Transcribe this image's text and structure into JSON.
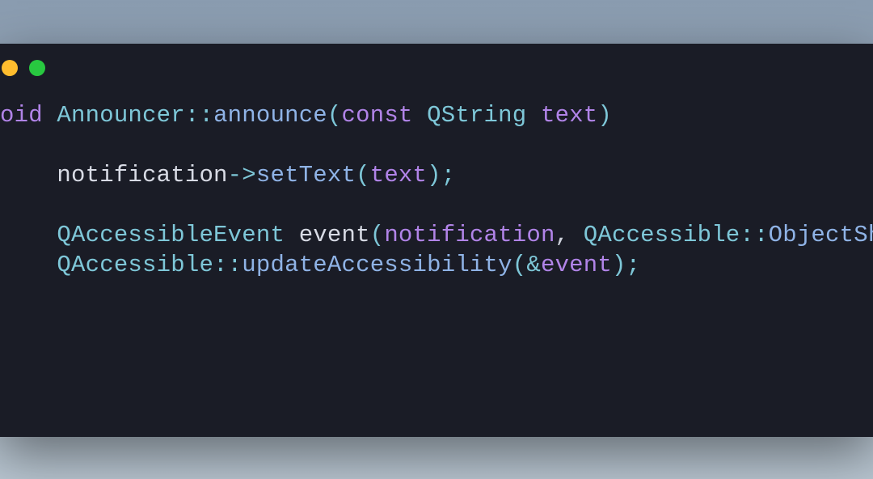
{
  "colors": {
    "traffic_yellow": "#ffbd2e",
    "traffic_green": "#28c840",
    "bg_window": "#1a1c26",
    "keyword": "#b184e8",
    "classname": "#7ec7d8",
    "function": "#8fb3e6",
    "variable": "#d8dbe5"
  },
  "code": {
    "l1": {
      "kw_return": "oid",
      "cls1": "Announcer",
      "scope": "::",
      "fn": "announce",
      "open": "(",
      "kw_const": "const",
      "cls2": "QString",
      "param": "text",
      "close": ")"
    },
    "l3": {
      "indent": "    ",
      "var": "notification",
      "arrow": "->",
      "fn": "setText",
      "open": "(",
      "arg": "text",
      "close_semi": ");"
    },
    "l5": {
      "indent": "    ",
      "cls": "QAccessibleEvent",
      "var": "event",
      "open": "(",
      "arg1": "notification",
      "comma": ", ",
      "cls2": "QAccessible",
      "scope": "::",
      "member": "ObjectShow",
      "close": ")"
    },
    "l6": {
      "indent": "    ",
      "cls": "QAccessible",
      "scope": "::",
      "fn": "updateAccessibility",
      "open": "(",
      "amp": "&",
      "arg": "event",
      "close_semi": ");"
    }
  }
}
